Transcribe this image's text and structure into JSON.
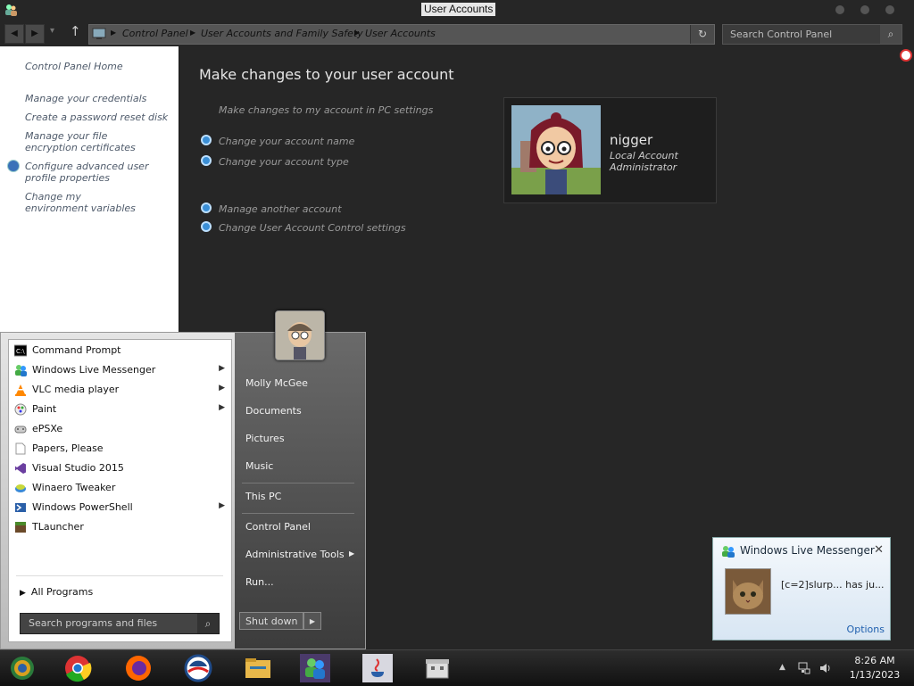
{
  "window": {
    "title": "User Accounts"
  },
  "breadcrumb": {
    "items": [
      "Control Panel",
      "User Accounts and Family Safety",
      "User Accounts"
    ]
  },
  "search": {
    "placeholder": "Search Control Panel"
  },
  "left_pane": {
    "home": "Control Panel Home",
    "links": [
      "Manage your credentials",
      "Create a password reset disk",
      "Manage your file encryption certificates",
      "Configure advanced user profile properties",
      "Change my environment variables"
    ]
  },
  "main": {
    "heading": "Make changes to your user account",
    "pc_settings_link": "Make changes to my account in PC settings",
    "tasks1": [
      "Change your account name",
      "Change your account type"
    ],
    "tasks2": [
      "Manage another account",
      "Change User Account Control settings"
    ],
    "account": {
      "name": "nigger",
      "type": "Local Account",
      "role": "Administrator"
    }
  },
  "start_menu": {
    "programs": [
      {
        "label": "Command Prompt",
        "icon": "cmd-icon",
        "arrow": ""
      },
      {
        "label": "Windows Live Messenger",
        "icon": "messenger-icon",
        "arrow": "▶"
      },
      {
        "label": "VLC media player",
        "icon": "vlc-icon",
        "arrow": "▶"
      },
      {
        "label": "Paint",
        "icon": "paint-icon",
        "arrow": "▶"
      },
      {
        "label": "ePSXe",
        "icon": "gamepad-icon",
        "arrow": ""
      },
      {
        "label": "Papers, Please",
        "icon": "document-icon",
        "arrow": ""
      },
      {
        "label": "Visual Studio 2015",
        "icon": "visual-studio-icon",
        "arrow": ""
      },
      {
        "label": "Winaero Tweaker",
        "icon": "tweaker-icon",
        "arrow": ""
      },
      {
        "label": "Windows PowerShell",
        "icon": "powershell-icon",
        "arrow": "▶"
      },
      {
        "label": "TLauncher",
        "icon": "minecraft-icon",
        "arrow": ""
      }
    ],
    "all_programs": "All Programs",
    "search_placeholder": "Search programs and files",
    "places": [
      "Molly McGee",
      "Documents",
      "Pictures",
      "Music",
      "This PC",
      "Control Panel",
      "Administrative Tools",
      "Run..."
    ],
    "shutdown": "Shut down"
  },
  "toast": {
    "title": "Windows Live Messenger",
    "message": "[c=2]slurp... has ju...",
    "options": "Options"
  },
  "clock": {
    "time": "8:26 AM",
    "date": "1/13/2023"
  }
}
